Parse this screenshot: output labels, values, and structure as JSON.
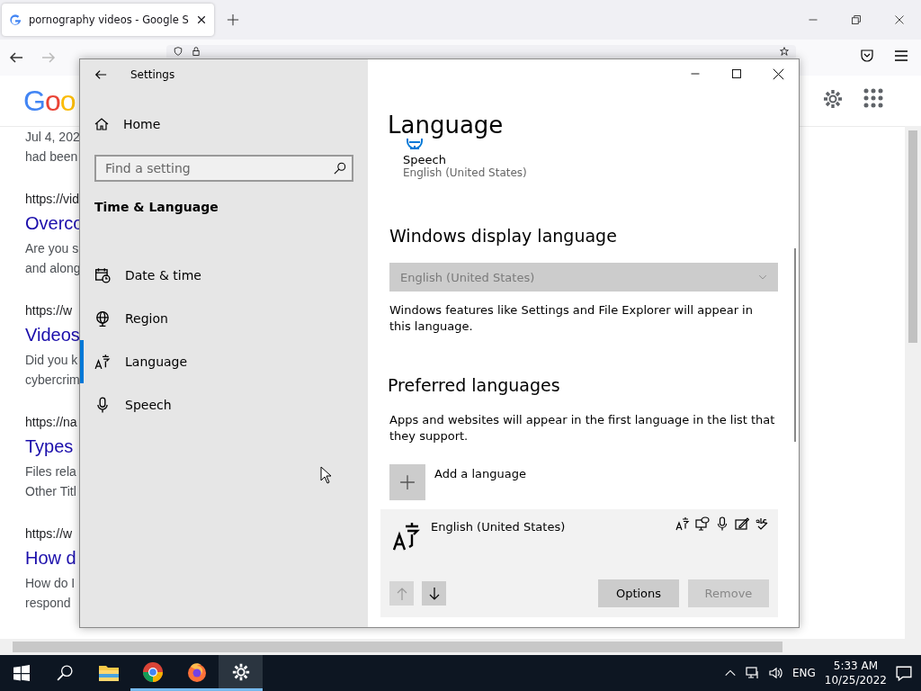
{
  "browser": {
    "tab": {
      "title": "pornography videos - Google S",
      "selected": true
    },
    "google_logo": "Goo",
    "results": [
      {
        "lines": [
          "Jul 4, 202",
          "had been"
        ]
      },
      {
        "url": "https://vid",
        "title": "Overco",
        "lines": [
          "Are you s",
          "and along"
        ]
      },
      {
        "url": "https://w",
        "title": "Videos",
        "lines": [
          "Did you k",
          "cybercrim"
        ]
      },
      {
        "url": "https://na",
        "title": "Types",
        "lines": [
          "Files rela",
          "Other Titl"
        ]
      },
      {
        "url": "https://w",
        "title": "How d",
        "lines": [
          "How do I",
          "respond"
        ]
      }
    ]
  },
  "settings": {
    "window_title": "Settings",
    "home": "Home",
    "search": {
      "placeholder": "Find a setting"
    },
    "section": "Time & Language",
    "nav_items": [
      {
        "label": "Date & time",
        "selected": false
      },
      {
        "label": "Region",
        "selected": false
      },
      {
        "label": "Language",
        "selected": true
      },
      {
        "label": "Speech",
        "selected": false
      }
    ],
    "heading": "Language",
    "speech": {
      "label": "Speech",
      "value": "English (United States)"
    },
    "display_language": {
      "heading": "Windows display language",
      "dropdown": {
        "value": "English (United States)",
        "disabled": true
      },
      "description": "Windows features like Settings and File Explorer will appear in this language."
    },
    "preferred": {
      "heading": "Preferred languages",
      "description": "Apps and websites will appear in the first language in the list that they support.",
      "add_button": "Add a language",
      "languages": [
        {
          "name": "English (United States)",
          "move_up_disabled": true,
          "move_down_disabled": false,
          "options": "Options",
          "remove": {
            "label": "Remove",
            "disabled": true
          }
        }
      ]
    }
  },
  "taskbar": {
    "apps": [
      {
        "running": false,
        "selected": false
      },
      {
        "running": true,
        "selected": false
      },
      {
        "running": true,
        "selected": false
      },
      {
        "running": true,
        "selected": true
      }
    ],
    "language": "ENG",
    "time": "5:33 AM",
    "date": "10/25/2022"
  }
}
